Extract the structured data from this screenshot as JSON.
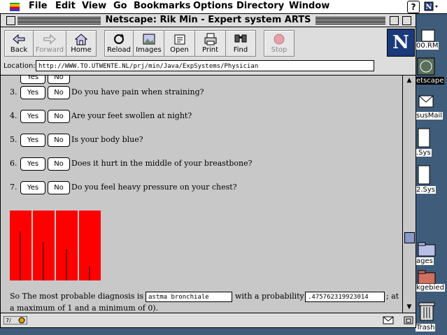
{
  "menubar": {
    "items": [
      "File",
      "Edit",
      "View",
      "Go",
      "Bookmarks",
      "Options",
      "Directory",
      "Window"
    ],
    "help_label": "?"
  },
  "desktop": {
    "labels": [
      "00.RM",
      "etscape",
      "susMail",
      ".Sys",
      "2.Sys",
      "ages",
      "kgebied",
      "Trash"
    ]
  },
  "window": {
    "title": "Netscape: Rik Min - Expert system ARTS"
  },
  "toolbar": {
    "back": "Back",
    "forward": "Forward",
    "home": "Home",
    "reload": "Reload",
    "images": "Images",
    "open": "Open",
    "print": "Print",
    "find": "Find",
    "stop": "Stop",
    "logo": "N"
  },
  "location": {
    "label": "Location:",
    "url": "http://WWW.TO.UTWENTE.NL/prj/min/Java/ExpSystems/Physician"
  },
  "questions": [
    {
      "num": "3.",
      "yes": "Yes",
      "no": "No",
      "text": "Do you have pain when straining?"
    },
    {
      "num": "4.",
      "yes": "Yes",
      "no": "No",
      "text": "Are your feet swollen at night?"
    },
    {
      "num": "5.",
      "yes": "Yes",
      "no": "No",
      "text": "Is your body blue?"
    },
    {
      "num": "6.",
      "yes": "Yes",
      "no": "No",
      "text": "Does it hurt in the middle of your breastbone?"
    },
    {
      "num": "7.",
      "yes": "Yes",
      "no": "No",
      "text": "Do you feel heavy pressure on your chest?"
    }
  ],
  "partial_question": {
    "yes": "Yes",
    "no": "No"
  },
  "diagnosis": {
    "prefix": "So The most probable diagnosis is",
    "value": "astma bronchiale",
    "middle": "with a probability of",
    "probability": ".475762319923014",
    "suffix": "; at",
    "line2": "a maximum of 1 and a minimum of 0)."
  },
  "bars": {
    "color": "#ff0000",
    "count": 4
  },
  "status": {
    "security_label": "7/"
  }
}
